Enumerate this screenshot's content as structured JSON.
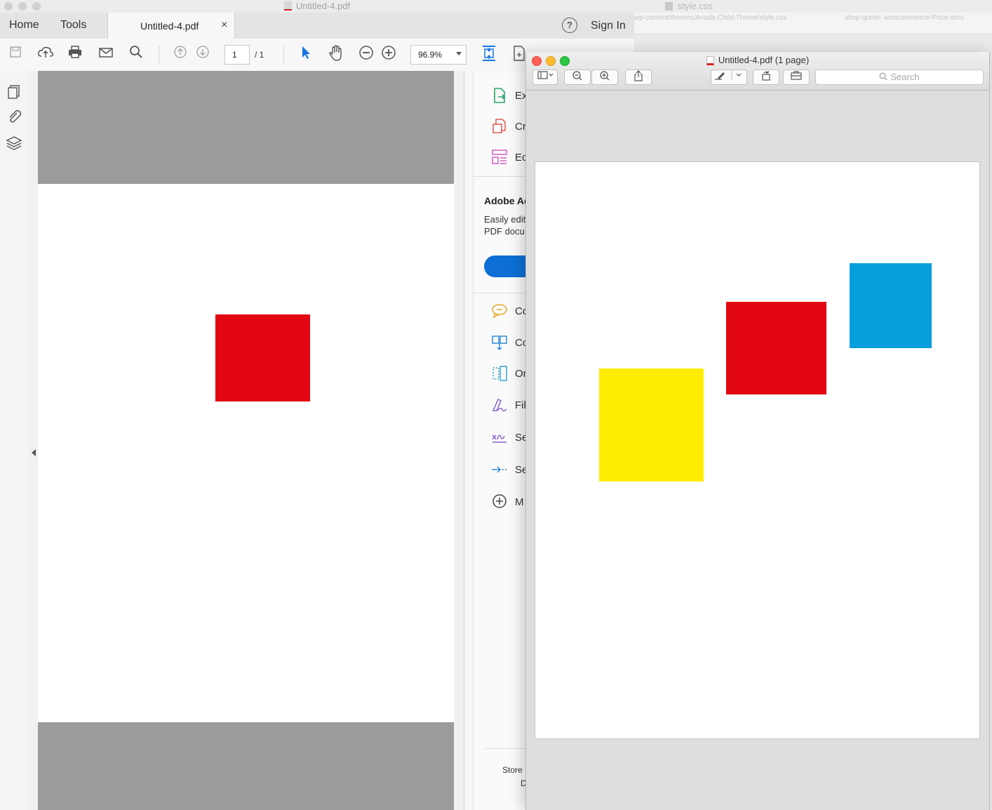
{
  "bg_window": {
    "title": "style.css",
    "path_text": "wp-content/themes/Avada-Child-Theme/style.css",
    "tab_text": "shop-quote- woocommerce-Price-amo"
  },
  "acrobat": {
    "title": "Untitled-4.pdf",
    "nav": {
      "home": "Home",
      "tools": "Tools"
    },
    "doc_tab": {
      "label": "Untitled-4.pdf",
      "close": "×"
    },
    "help": "?",
    "sign_in": "Sign In",
    "toolbar": {
      "page_current": "1",
      "page_total": "/ 1",
      "zoom": "96.9%"
    },
    "right_panel": {
      "tools": [
        {
          "label": "Ex",
          "icon": "export-pdf-icon"
        },
        {
          "label": "Cr",
          "icon": "create-pdf-icon"
        },
        {
          "label": "Ec",
          "icon": "edit-pdf-icon"
        }
      ],
      "promo_title": "Adobe Ac",
      "promo_line1": "Easily edit",
      "promo_line2": "PDF docu",
      "tools2": [
        {
          "label": "Co",
          "icon": "comment-icon"
        },
        {
          "label": "Co",
          "icon": "combine-files-icon"
        },
        {
          "label": "Or",
          "icon": "organize-pages-icon"
        },
        {
          "label": "Fil",
          "icon": "fill-sign-icon"
        },
        {
          "label": "Se",
          "icon": "send-for-signature-icon"
        },
        {
          "label": "Se",
          "icon": "send-track-icon"
        },
        {
          "label": "M",
          "icon": "more-tools-icon"
        }
      ],
      "footer1": "Store",
      "footer2": "D"
    },
    "colors": {
      "red_square": "#e20613"
    }
  },
  "preview": {
    "title": "Untitled-4.pdf (1 page)",
    "search_placeholder": "Search",
    "colors": {
      "yellow": "#ffed00",
      "red": "#e20613",
      "blue": "#079ede"
    }
  }
}
